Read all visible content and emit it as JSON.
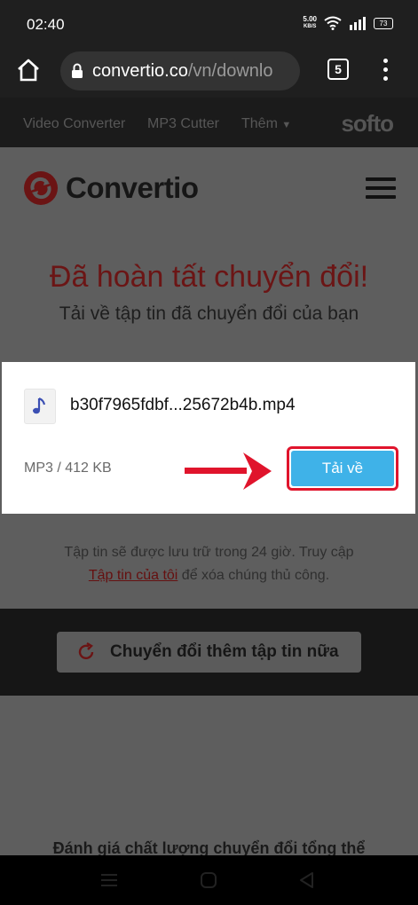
{
  "status_bar": {
    "time": "02:40",
    "speed_value": "5.00",
    "speed_unit": "KB/S",
    "battery": "73"
  },
  "browser": {
    "url_host": "convertio.co",
    "url_path": "/vn/downlo",
    "tab_count": "5"
  },
  "site_nav": {
    "links": [
      "Video Converter",
      "MP3 Cutter",
      "Thêm"
    ],
    "brand": "softo"
  },
  "page": {
    "logo_text": "Convertio",
    "title": "Đã hoàn tất chuyển đổi!",
    "subtitle": "Tải về tập tin đã chuyển đổi của bạn",
    "storage_note_before": "Tập tin sẽ được lưu trữ trong 24 giờ. Truy cập",
    "storage_note_link": "Tập tin của tôi",
    "storage_note_after": " để xóa chúng thủ công.",
    "convert_more_label": "Chuyển đổi thêm tập tin nữa",
    "rating_text": "Đánh giá chất lượng chuyển đổi tổng thể"
  },
  "dialog": {
    "file_name": "b30f7965fdbf...25672b4b.mp4",
    "file_meta": "MP3 / 412 KB",
    "download_label": "Tải về"
  },
  "colors": {
    "accent_red": "#e0142c",
    "download_blue": "#3fb2e8"
  }
}
